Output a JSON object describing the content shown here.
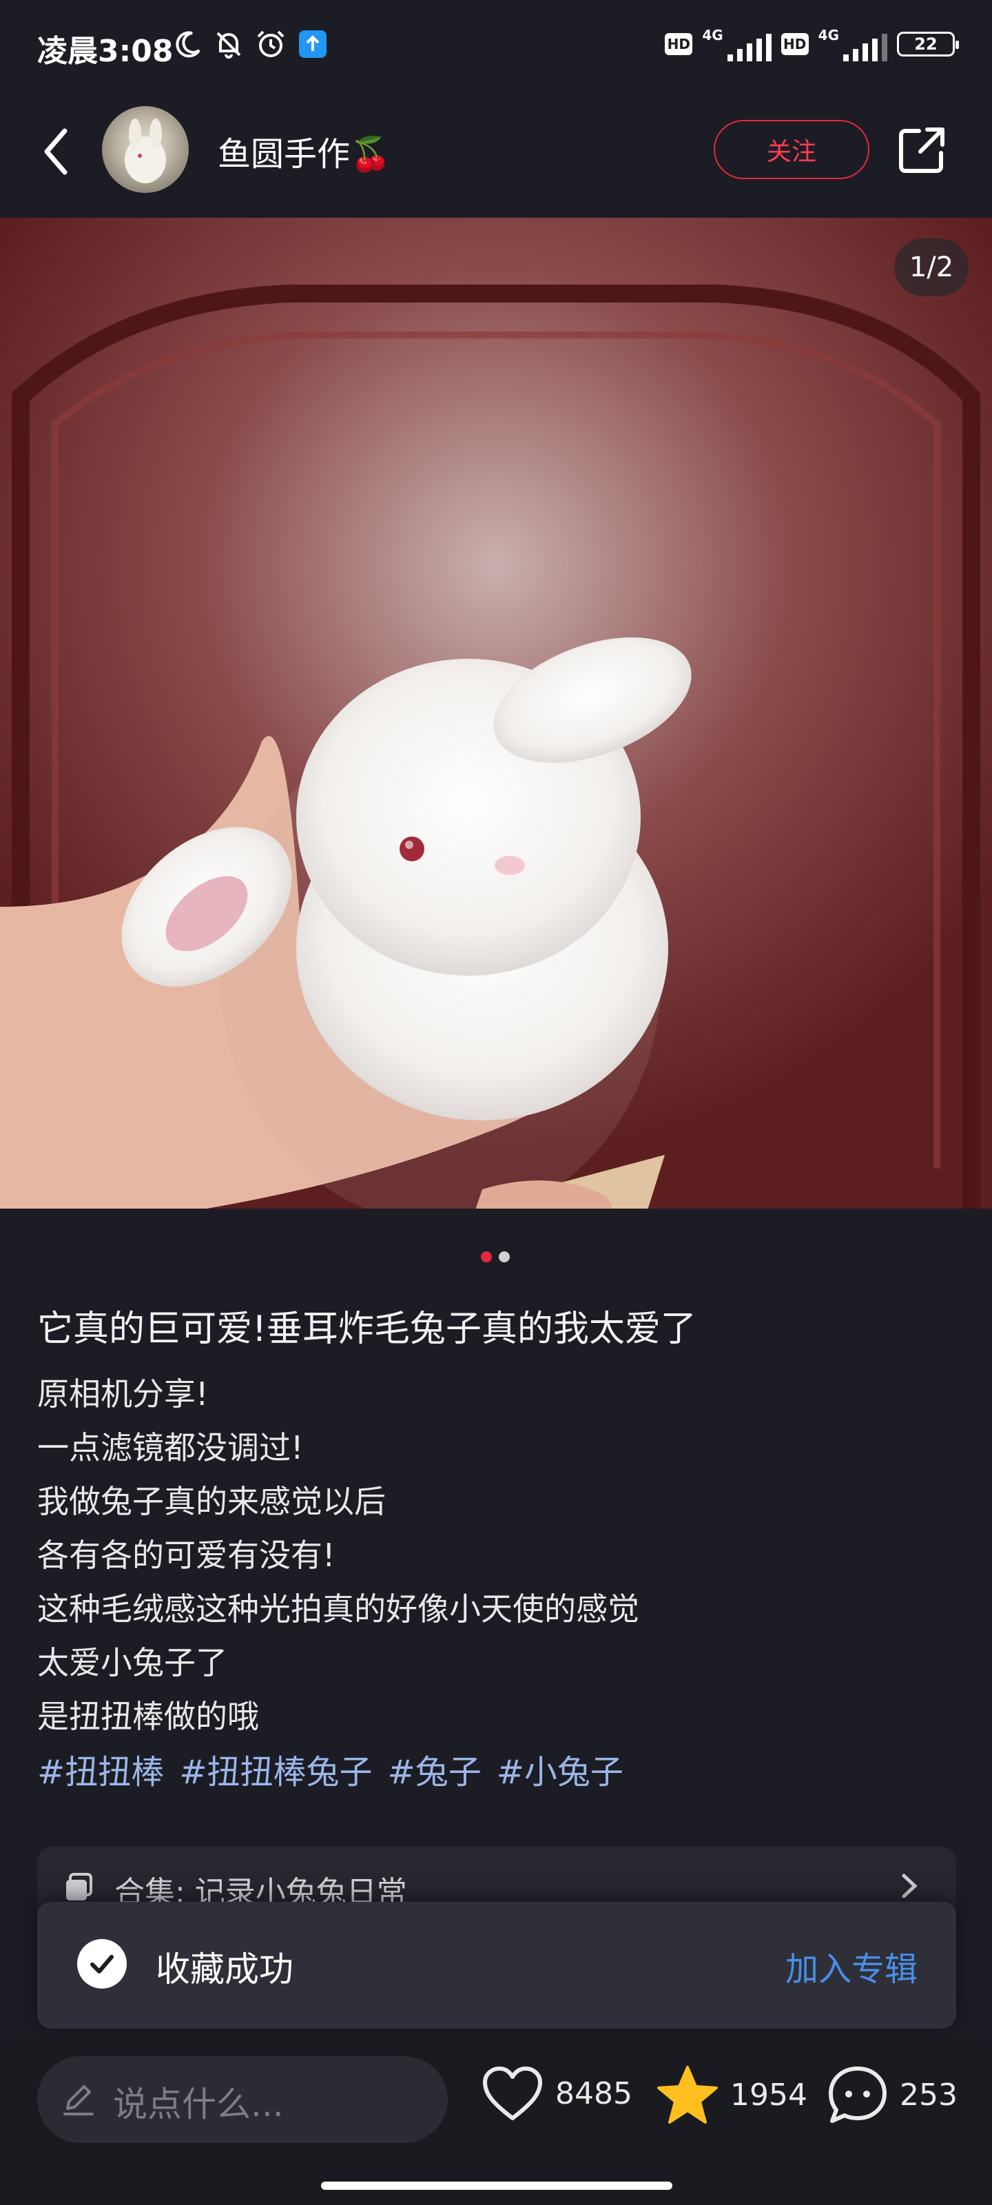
{
  "status_bar": {
    "time": "凌晨3:08",
    "icons": [
      "moon-icon",
      "bell-off-icon",
      "alarm-icon",
      "upload-app-icon"
    ],
    "hd_label": "HD",
    "network_label": "4G",
    "battery": "22"
  },
  "header": {
    "author_name": "鱼圆手作🍒",
    "follow_label": "关注",
    "back_icon": "chevron-left-icon",
    "share_icon": "share-icon"
  },
  "photo": {
    "page_counter": "1/2",
    "current_page": 1,
    "total_pages": 2
  },
  "colors": {
    "accent_red": "#e5283f",
    "link_blue": "#4a8fe8",
    "tag_blue": "#9bb6e8",
    "background": "#1c1c24",
    "star_yellow": "#ffbf1f"
  },
  "post": {
    "title": "它真的巨可爱!垂耳炸毛兔子真的我太爱了",
    "body": [
      "原相机分享!",
      "一点滤镜都没调过!",
      "我做兔子真的来感觉以后",
      "各有各的可爱有没有!",
      "这种毛绒感这种光拍真的好像小天使的感觉",
      "太爱小兔子了",
      "是扭扭棒做的哦"
    ],
    "tags": [
      "#扭扭棒",
      "#扭扭棒兔子",
      "#兔子",
      "#小兔子"
    ]
  },
  "collection": {
    "label": "合集: 记录小兔兔日常"
  },
  "toast": {
    "message": "收藏成功",
    "action_label": "加入专辑"
  },
  "bottom_bar": {
    "comment_placeholder": "说点什么...",
    "likes": "8485",
    "favorites": "1954",
    "comments": "253"
  }
}
